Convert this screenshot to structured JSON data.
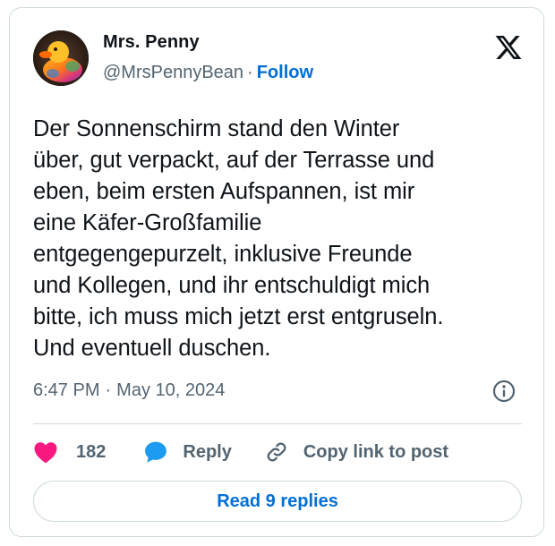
{
  "author": {
    "name": "Mrs. Penny",
    "handle": "@MrsPennyBean",
    "separator": "·",
    "follow_label": "Follow",
    "avatar_icon": "rubber-duck-avatar"
  },
  "brand": {
    "logo_icon": "x-logo",
    "accent_color": "#006fd6",
    "like_color": "#f91880",
    "reply_color": "#1d9bf0"
  },
  "tweet": {
    "text": "Der Sonnenschirm stand den Winter\nüber, gut verpackt, auf der Terrasse und\neben, beim ersten Aufspannen, ist mir\neine Käfer-Großfamilie\nentgegengepurzelt, inklusive Freunde\nund Kollegen, und ihr entschuldigt mich\nbitte, ich muss mich jetzt erst entgruseln.\nUnd eventuell duschen.",
    "time": "6:47 PM",
    "date": "May 10, 2024",
    "meta_separator": "·"
  },
  "actions": {
    "like_count": "182",
    "reply_label": "Reply",
    "copy_label": "Copy link to post"
  },
  "footer": {
    "read_replies_label": "Read 9 replies"
  }
}
